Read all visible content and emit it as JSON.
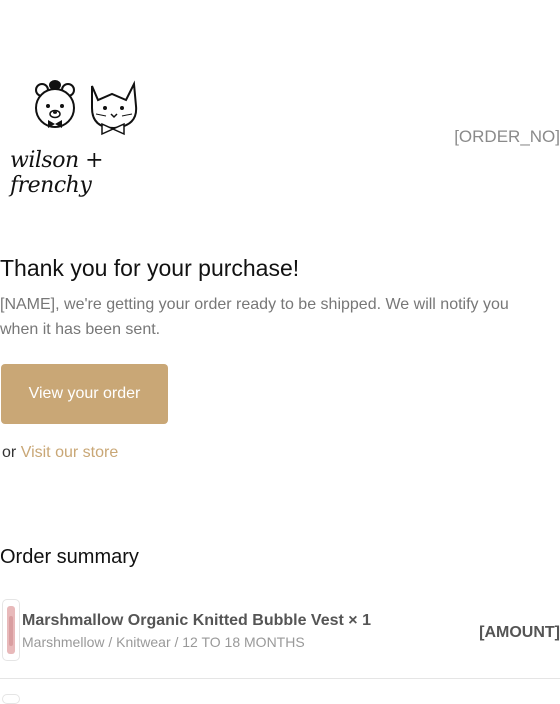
{
  "header": {
    "logo_text": "wilson + frenchy",
    "order_number": "[ORDER_NO]"
  },
  "main": {
    "title": "Thank you for your purchase!",
    "message": "[NAME], we're getting your order ready to be shipped. We will notify you when it has been sent.",
    "view_order_label": "View your order",
    "or_text": "or",
    "visit_store_label": "Visit our store"
  },
  "summary": {
    "title": "Order summary",
    "items": [
      {
        "name": "Marshmallow Organic Knitted Bubble Vest × 1",
        "variant": "Marshmellow / Knitwear / 12 TO 18 MONTHS",
        "amount": "[AMOUNT]"
      }
    ]
  },
  "colors": {
    "accent": "#c9a776",
    "muted_text": "#777777"
  }
}
